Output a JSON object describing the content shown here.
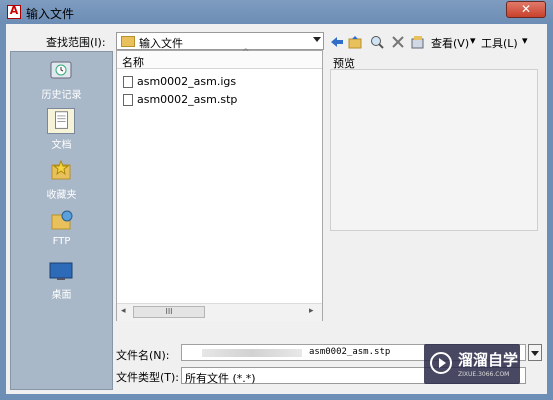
{
  "window": {
    "title": "输入文件",
    "close_label": "✕"
  },
  "look_in": {
    "label": "查找范围(I):",
    "value": "输入文件"
  },
  "toolbar": {
    "view_label": "查看(V)",
    "tools_label": "工具(L)"
  },
  "places": [
    {
      "label": "历史记录",
      "icon": "history-icon"
    },
    {
      "label": "文档",
      "icon": "documents-icon"
    },
    {
      "label": "收藏夹",
      "icon": "favorites-icon"
    },
    {
      "label": "FTP",
      "icon": "ftp-icon"
    },
    {
      "label": "桌面",
      "icon": "desktop-icon"
    }
  ],
  "file_list": {
    "column_header": "名称",
    "files": [
      "asm0002_asm.igs",
      "asm0002_asm.stp"
    ],
    "scroll_thumb_label": "III"
  },
  "preview": {
    "label": "预览"
  },
  "filename": {
    "label": "文件名(N):",
    "value": "asm0002_asm.stp"
  },
  "filetype": {
    "label": "文件类型(T):",
    "value": "所有文件 (*.*)"
  },
  "watermark": {
    "title": "溜溜自学",
    "subtitle": "ZIXUE.3066.COM"
  }
}
